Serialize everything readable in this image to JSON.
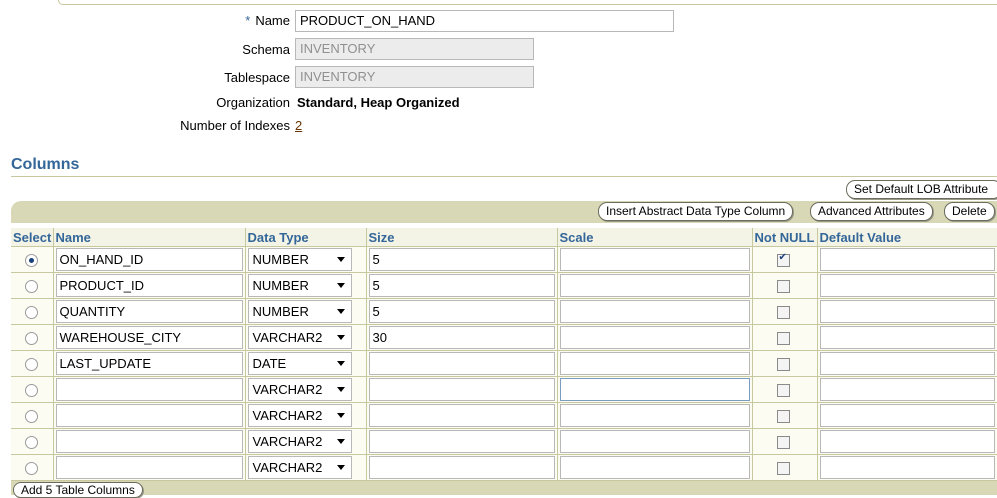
{
  "form": {
    "name_required_marker": "*",
    "name_label": "Name",
    "name_value": "PRODUCT_ON_HAND",
    "schema_label": "Schema",
    "schema_value": "INVENTORY",
    "tablespace_label": "Tablespace",
    "tablespace_value": "INVENTORY",
    "organization_label": "Organization",
    "organization_value": "Standard, Heap Organized",
    "indexes_label": "Number of Indexes",
    "indexes_value": "2"
  },
  "columns_section": {
    "title": "Columns",
    "set_default_lob_button": "Set Default LOB Attribute",
    "insert_adt_button": "Insert Abstract Data Type Column",
    "advanced_attributes_button": "Advanced Attributes",
    "delete_button": "Delete",
    "add_columns_button": "Add 5 Table Columns",
    "headers": [
      "Select",
      "Name",
      "Data Type",
      "Size",
      "Scale",
      "Not NULL",
      "Default Value"
    ],
    "rows": [
      {
        "selected": true,
        "name": "ON_HAND_ID",
        "type": "NUMBER",
        "size": "5",
        "scale": "",
        "not_null": true,
        "default": ""
      },
      {
        "selected": false,
        "name": "PRODUCT_ID",
        "type": "NUMBER",
        "size": "5",
        "scale": "",
        "not_null": false,
        "default": ""
      },
      {
        "selected": false,
        "name": "QUANTITY",
        "type": "NUMBER",
        "size": "5",
        "scale": "",
        "not_null": false,
        "default": ""
      },
      {
        "selected": false,
        "name": "WAREHOUSE_CITY",
        "type": "VARCHAR2",
        "size": "30",
        "scale": "",
        "not_null": false,
        "default": ""
      },
      {
        "selected": false,
        "name": "LAST_UPDATE",
        "type": "DATE",
        "size": "",
        "scale": "",
        "not_null": false,
        "default": ""
      },
      {
        "selected": false,
        "name": "",
        "type": "VARCHAR2",
        "size": "",
        "scale": "",
        "not_null": false,
        "default": ""
      },
      {
        "selected": false,
        "name": "",
        "type": "VARCHAR2",
        "size": "",
        "scale": "",
        "not_null": false,
        "default": ""
      },
      {
        "selected": false,
        "name": "",
        "type": "VARCHAR2",
        "size": "",
        "scale": "",
        "not_null": false,
        "default": ""
      },
      {
        "selected": false,
        "name": "",
        "type": "VARCHAR2",
        "size": "",
        "scale": "",
        "not_null": false,
        "default": ""
      }
    ]
  },
  "colors": {
    "accent": "#336699",
    "toolbar_bg": "#d8d8b6",
    "link": "#663300"
  }
}
